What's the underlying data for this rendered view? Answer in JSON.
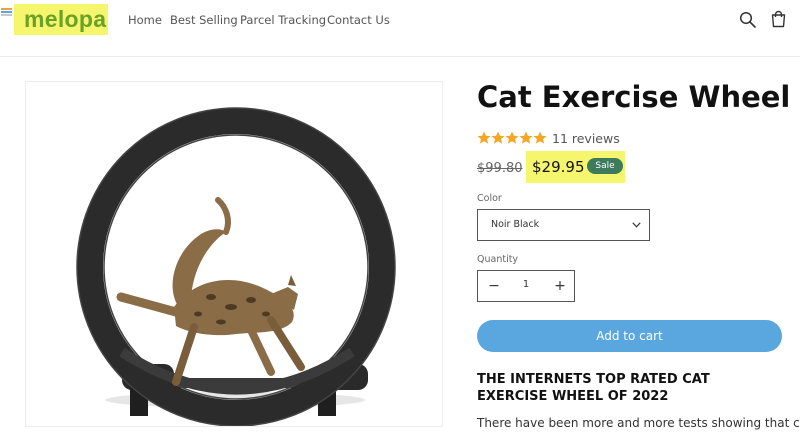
{
  "header": {
    "logo": "melopa",
    "nav": [
      "Home",
      "Best Selling",
      "Parcel Tracking",
      "Contact Us"
    ],
    "icons": [
      "search-icon",
      "cart-icon"
    ]
  },
  "product": {
    "title": "Cat Exercise Wheel",
    "rating": 5,
    "reviews": "11 reviews",
    "original_price": "$99.80",
    "price": "$29.95",
    "badge": "Sale",
    "color_label": "Color",
    "color_value": "Noir Black",
    "quantity_label": "Quantity",
    "quantity": "1",
    "add_to_cart": "Add to cart",
    "description_heading": "THE INTERNETS TOP RATED CAT EXERCISE WHEEL OF 2022",
    "description": "There have been more and more tests showing that cats"
  },
  "colors": {
    "highlight": "#f6f56e",
    "logo_green": "#6aa127",
    "star": "#f5a623",
    "sale_badge": "#3e7a5c",
    "cart_button": "#5aa6de"
  }
}
